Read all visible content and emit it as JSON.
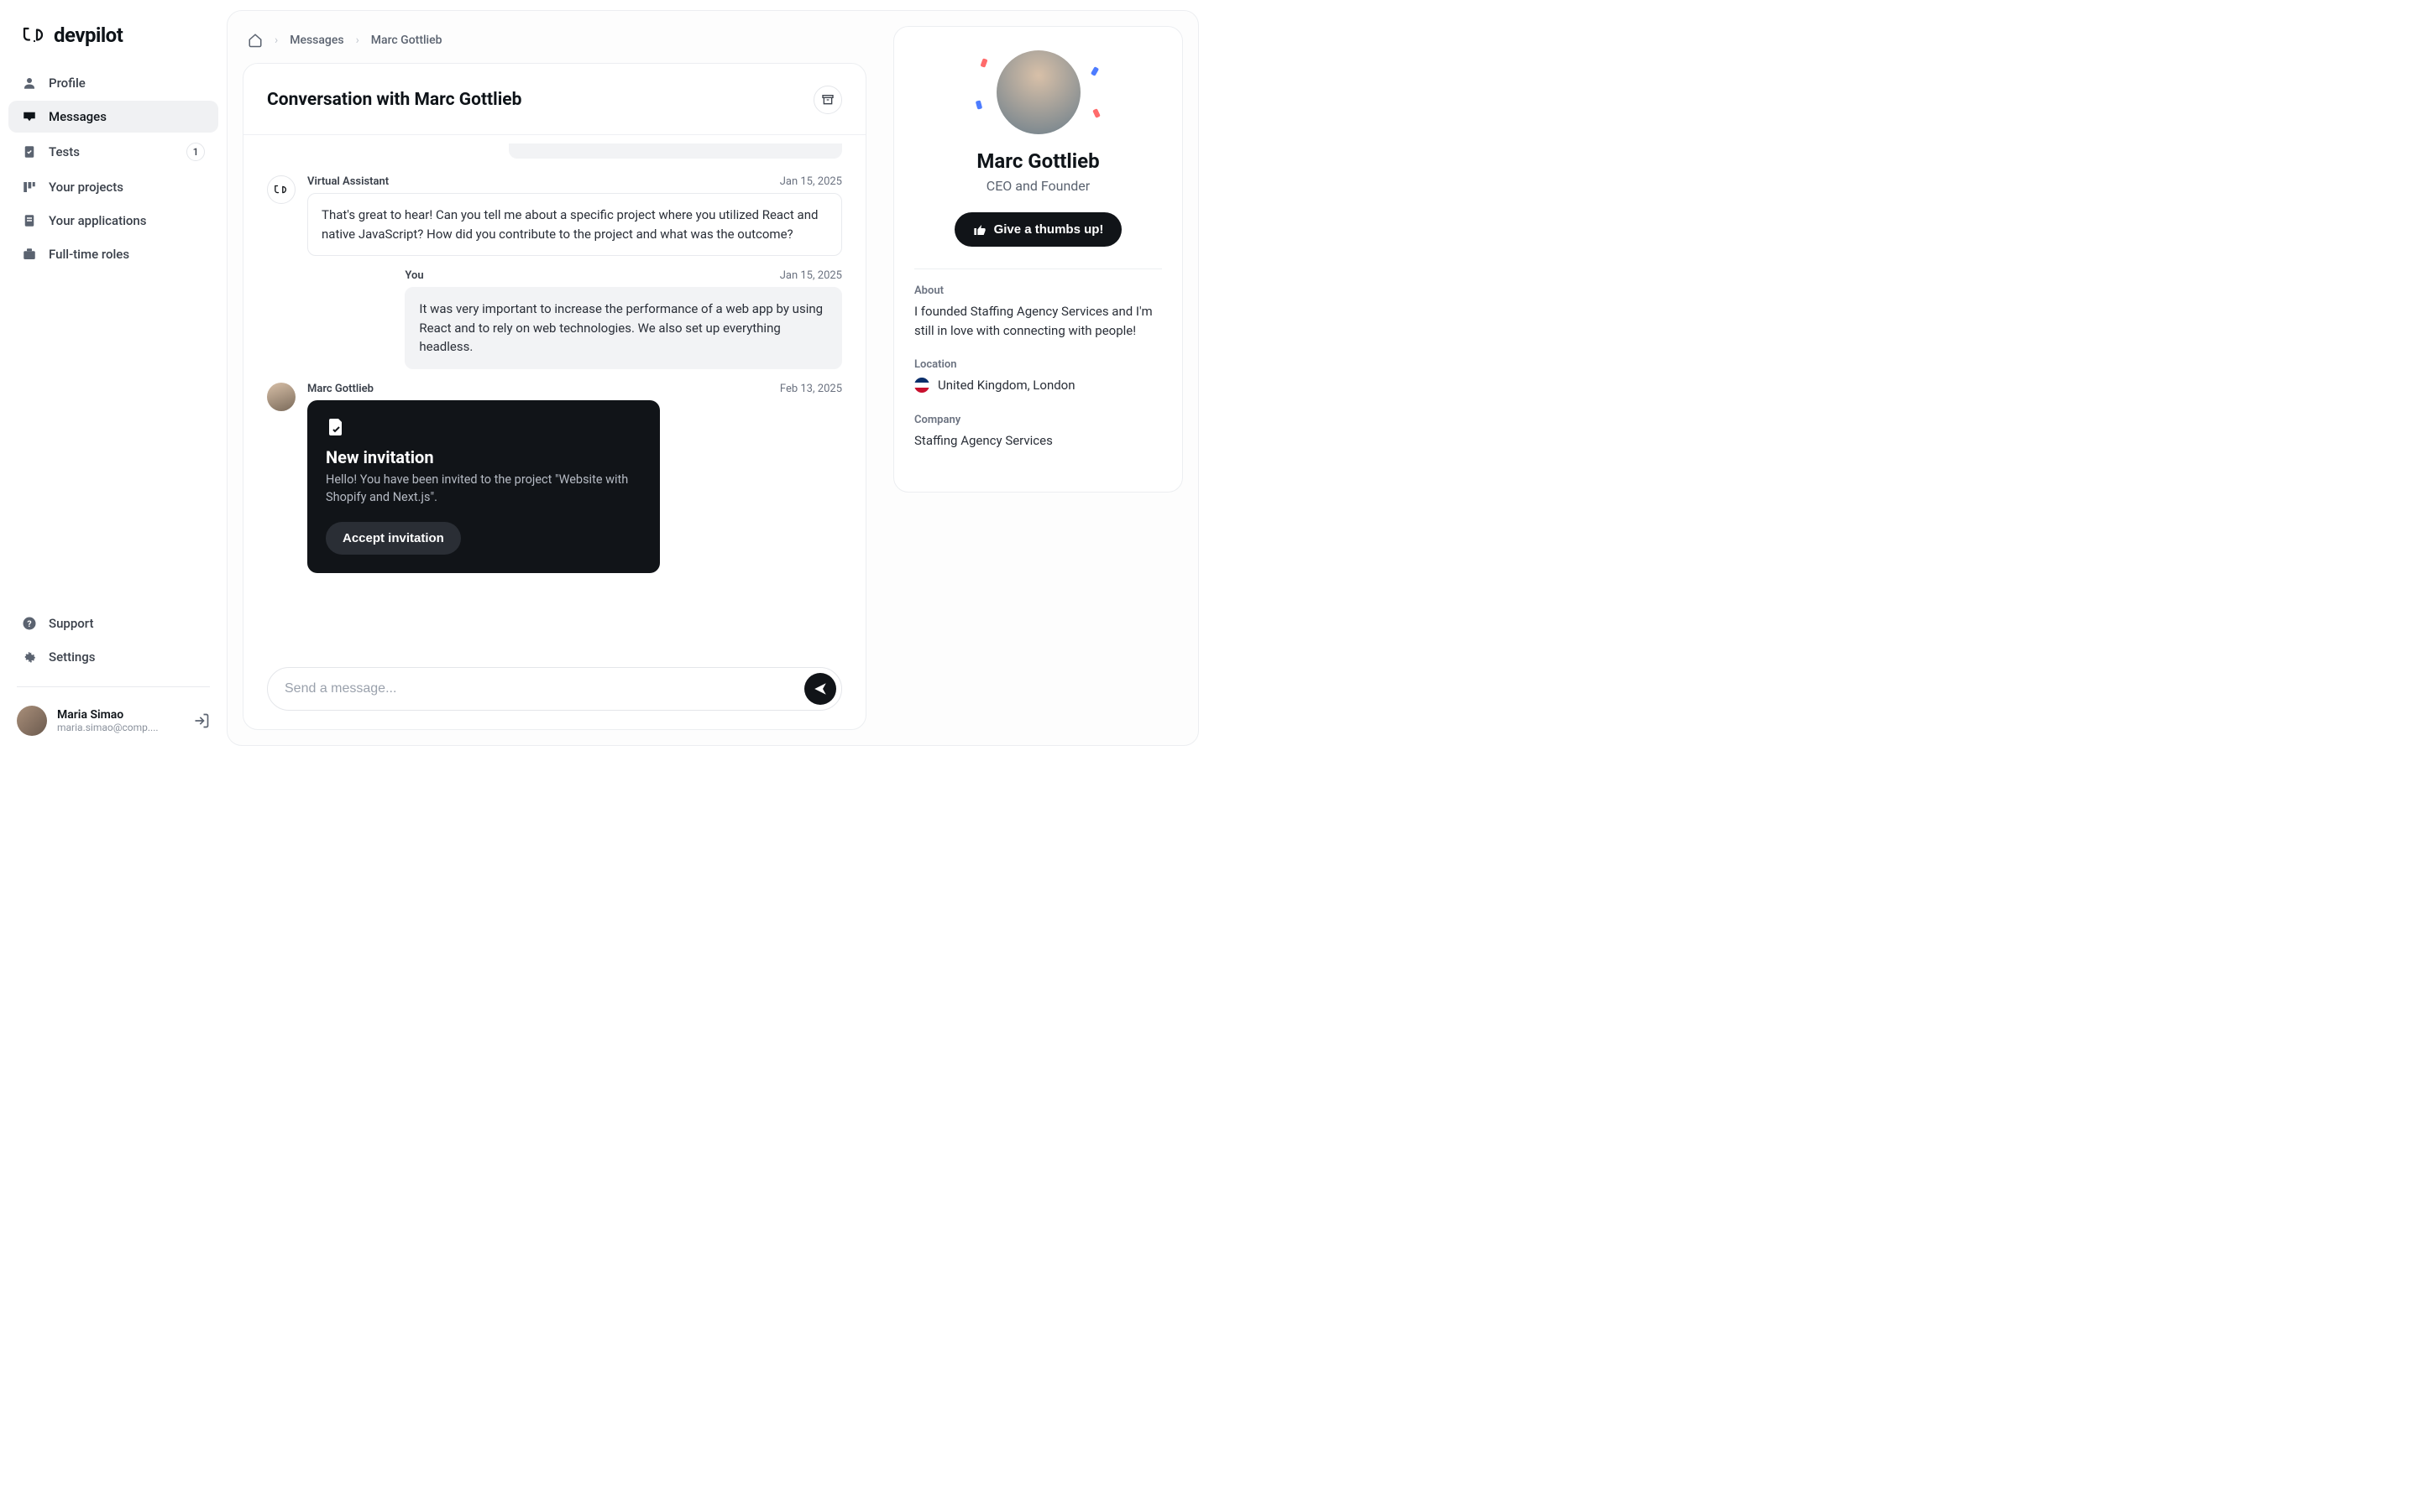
{
  "brand": {
    "name": "devpilot"
  },
  "sidebar": {
    "items": [
      {
        "label": "Profile"
      },
      {
        "label": "Messages"
      },
      {
        "label": "Tests",
        "badge": "1"
      },
      {
        "label": "Your projects"
      },
      {
        "label": "Your applications"
      },
      {
        "label": "Full-time roles"
      }
    ],
    "bottom": [
      {
        "label": "Support"
      },
      {
        "label": "Settings"
      }
    ]
  },
  "user": {
    "name": "Maria Simao",
    "email": "maria.simao@comp...."
  },
  "breadcrumb": {
    "items": [
      "Messages",
      "Marc Gottlieb"
    ]
  },
  "conversation": {
    "title": "Conversation with Marc Gottlieb",
    "messages": {
      "assistant": {
        "sender": "Virtual Assistant",
        "date": "Jan 15, 2025",
        "text": "That's great to hear! Can you tell me about a specific project where you utilized React and native JavaScript? How did you contribute to the project and what was the outcome?"
      },
      "you": {
        "sender": "You",
        "date": "Jan 15, 2025",
        "text": "It was very important to increase the performance of a web app by using React and to rely on web technologies. We also set up everything headless."
      },
      "contact": {
        "sender": "Marc Gottlieb",
        "date": "Feb 13, 2025",
        "invite": {
          "title": "New invitation",
          "text": "Hello! You have been invited to the project \"Website with Shopify and Next.js\".",
          "button": "Accept invitation"
        }
      }
    },
    "composer": {
      "placeholder": "Send a message..."
    }
  },
  "profile": {
    "name": "Marc Gottlieb",
    "role": "CEO and Founder",
    "thumbs_label": "Give a thumbs up!",
    "about_label": "About",
    "about_text": "I founded Staffing Agency Services and I'm still in love with connecting with people!",
    "location_label": "Location",
    "location_text": "United Kingdom, London",
    "company_label": "Company",
    "company_text": "Staffing Agency Services"
  }
}
